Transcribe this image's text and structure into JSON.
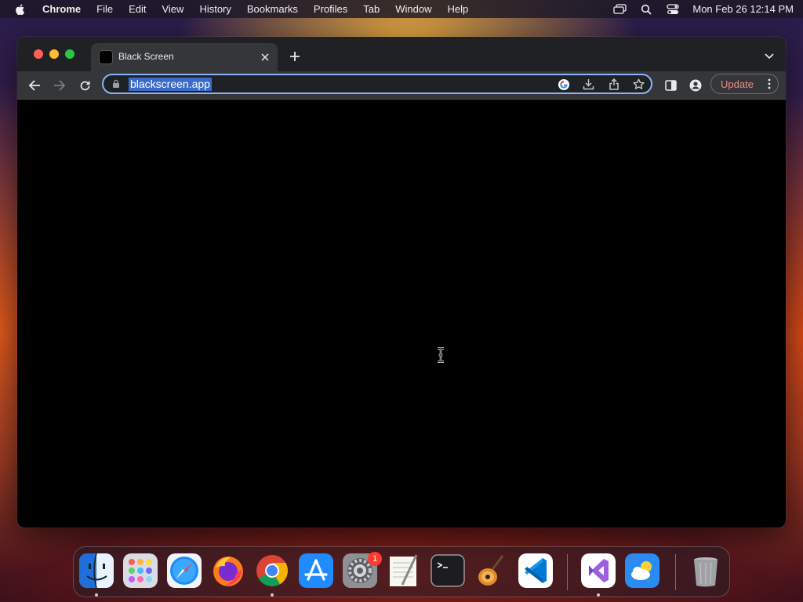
{
  "menubar": {
    "app_name": "Chrome",
    "items": [
      "File",
      "Edit",
      "View",
      "History",
      "Bookmarks",
      "Profiles",
      "Tab",
      "Window",
      "Help"
    ],
    "clock": "Mon Feb 26  12:14 PM"
  },
  "browser": {
    "tab": {
      "title": "Black Screen"
    },
    "omnibox": {
      "url": "blackscreen.app"
    },
    "update_label": "Update",
    "page_background": "#000000"
  },
  "dock": {
    "apps": [
      "finder",
      "launchpad",
      "safari",
      "firefox",
      "chrome",
      "app-store",
      "system-settings",
      "textedit",
      "terminal",
      "garageband",
      "vscode",
      "visual-studio",
      "weather",
      "trash"
    ],
    "system_settings_badge": "1"
  },
  "colors": {
    "accent": "#8ab4f8",
    "update_text": "#f28b82",
    "selection": "#3a6bc9"
  }
}
